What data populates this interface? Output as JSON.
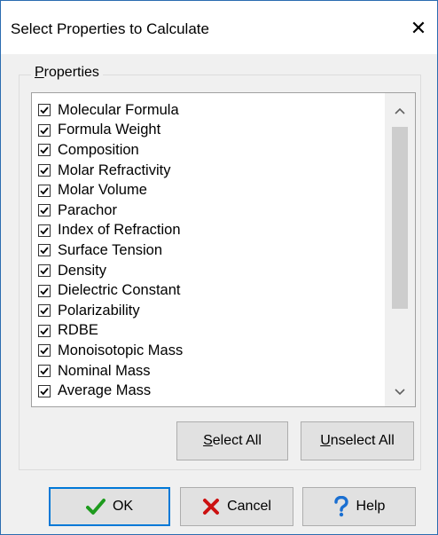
{
  "window": {
    "title": "Select Properties to Calculate",
    "close_glyph": "✕"
  },
  "group": {
    "label_mnemonic": "P",
    "label_rest": "roperties"
  },
  "properties": [
    {
      "label": "Molecular Formula",
      "checked": true
    },
    {
      "label": "Formula Weight",
      "checked": true
    },
    {
      "label": "Composition",
      "checked": true
    },
    {
      "label": "Molar Refractivity",
      "checked": true
    },
    {
      "label": "Molar Volume",
      "checked": true
    },
    {
      "label": "Parachor",
      "checked": true
    },
    {
      "label": "Index of Refraction",
      "checked": true
    },
    {
      "label": "Surface Tension",
      "checked": true
    },
    {
      "label": "Density",
      "checked": true
    },
    {
      "label": "Dielectric Constant",
      "checked": true
    },
    {
      "label": "Polarizability",
      "checked": true
    },
    {
      "label": "RDBE",
      "checked": true
    },
    {
      "label": "Monoisotopic Mass",
      "checked": true
    },
    {
      "label": "Nominal Mass",
      "checked": true
    },
    {
      "label": "Average Mass",
      "checked": true
    }
  ],
  "buttons": {
    "select_all_mnemonic": "S",
    "select_all_rest": "elect All",
    "unselect_all_mnemonic": "U",
    "unselect_all_rest": "nselect All",
    "ok": "OK",
    "cancel": "Cancel",
    "help": "Help"
  },
  "icons": {
    "ok": "checkmark-icon",
    "cancel": "x-icon",
    "help": "question-mark-icon"
  },
  "colors": {
    "ok_icon": "#1e9b1e",
    "cancel_icon": "#cc1111",
    "help_icon": "#1a6fd1",
    "focus_border": "#0078d7"
  }
}
